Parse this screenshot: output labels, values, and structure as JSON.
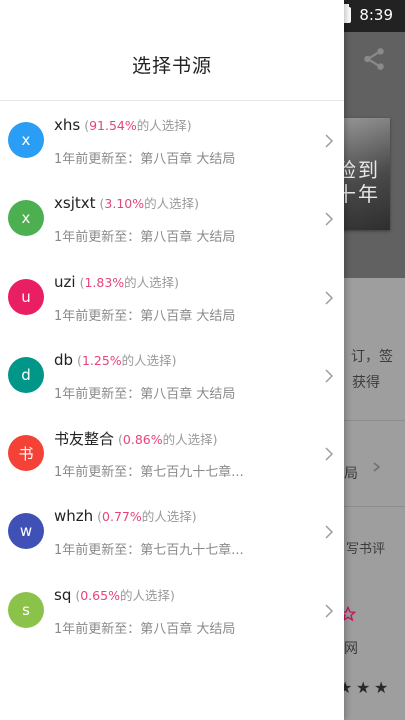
{
  "status_bar": {
    "time": "8:39",
    "battery_icon": "battery-charging-icon"
  },
  "background": {
    "cover_text": "殓到十年",
    "text_line1": "订，签",
    "text_line2": "获得",
    "text_line3": "局",
    "text_line4": "写书评",
    "text_line5": "网",
    "accent_color": "#e6457a"
  },
  "drawer": {
    "title": "选择书源",
    "sources": [
      {
        "avatar": "x",
        "name": "xhs",
        "percent": "91.54%",
        "suffix": "的人选择)",
        "prefix": "(",
        "latest": "1年前更新至：第八百章 大结局",
        "color": "#2a9df4"
      },
      {
        "avatar": "x",
        "name": "xsjtxt",
        "percent": "3.10%",
        "suffix": "的人选择)",
        "prefix": "(",
        "latest": "1年前更新至：第八百章 大结局",
        "color": "#4caf50"
      },
      {
        "avatar": "u",
        "name": "uzi",
        "percent": "1.83%",
        "suffix": "的人选择)",
        "prefix": "(",
        "latest": "1年前更新至：第八百章 大结局",
        "color": "#e91e63"
      },
      {
        "avatar": "d",
        "name": "db",
        "percent": "1.25%",
        "suffix": "的人选择)",
        "prefix": "(",
        "latest": "1年前更新至：第八百章 大结局",
        "color": "#009688"
      },
      {
        "avatar": "书",
        "name": "书友整合",
        "percent": "0.86%",
        "suffix": "的人选择)",
        "prefix": "(",
        "latest": "1年前更新至：第七百九十七章...",
        "color": "#f44336"
      },
      {
        "avatar": "w",
        "name": "whzh",
        "percent": "0.77%",
        "suffix": "的人选择)",
        "prefix": "(",
        "latest": "1年前更新至：第七百九十七章...",
        "color": "#3f51b5"
      },
      {
        "avatar": "s",
        "name": "sq",
        "percent": "0.65%",
        "suffix": "的人选择)",
        "prefix": "(",
        "latest": "1年前更新至：第八百章 大结局",
        "color": "#8bc34a"
      }
    ]
  }
}
